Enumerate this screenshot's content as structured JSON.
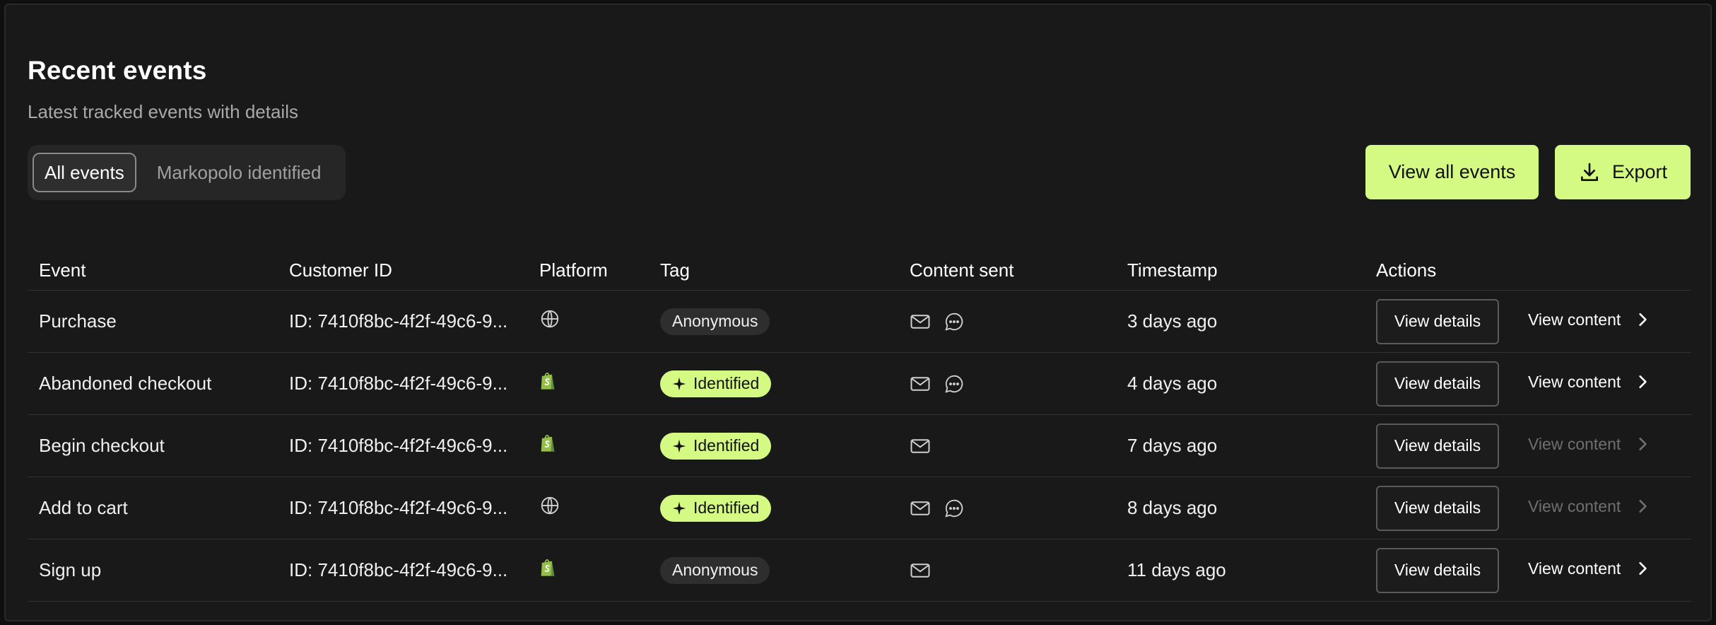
{
  "header": {
    "title": "Recent events",
    "subtitle": "Latest tracked events with details"
  },
  "filters": {
    "options": [
      "All events",
      "Markopolo identified"
    ],
    "selected": "All events"
  },
  "buttons": {
    "view_all": "View all events",
    "export": "Export"
  },
  "table": {
    "columns": [
      "Event",
      "Customer ID",
      "Platform",
      "Tag",
      "Content sent",
      "Timestamp",
      "Actions"
    ],
    "rows": [
      {
        "event": "Purchase",
        "customer_id": "ID: 7410f8bc-4f2f-49c6-9...",
        "platform": "globe-icon",
        "tag": "Anonymous",
        "tag_type": "anon",
        "content": [
          "mail-icon",
          "chat-icon"
        ],
        "timestamp": "3 days ago",
        "details": "View details",
        "view_content": "View content",
        "content_enabled": true
      },
      {
        "event": "Abandoned checkout",
        "customer_id": "ID: 7410f8bc-4f2f-49c6-9...",
        "platform": "shopify-icon",
        "tag": "Identified",
        "tag_type": "ident",
        "content": [
          "mail-icon",
          "chat-icon"
        ],
        "timestamp": "4 days ago",
        "details": "View details",
        "view_content": "View content",
        "content_enabled": true
      },
      {
        "event": "Begin checkout",
        "customer_id": "ID: 7410f8bc-4f2f-49c6-9...",
        "platform": "shopify-icon",
        "tag": "Identified",
        "tag_type": "ident",
        "content": [
          "mail-icon"
        ],
        "timestamp": "7 days ago",
        "details": "View details",
        "view_content": "View content",
        "content_enabled": false
      },
      {
        "event": "Add to cart",
        "customer_id": "ID: 7410f8bc-4f2f-49c6-9...",
        "platform": "globe-icon",
        "tag": "Identified",
        "tag_type": "ident",
        "content": [
          "mail-icon",
          "chat-icon"
        ],
        "timestamp": "8 days ago",
        "details": "View details",
        "view_content": "View content",
        "content_enabled": false
      },
      {
        "event": "Sign up",
        "customer_id": "ID: 7410f8bc-4f2f-49c6-9...",
        "platform": "shopify-icon",
        "tag": "Anonymous",
        "tag_type": "anon",
        "content": [
          "mail-icon"
        ],
        "timestamp": "11 days ago",
        "details": "View details",
        "view_content": "View content",
        "content_enabled": true
      }
    ]
  },
  "colors": {
    "accent": "#d4fa83",
    "background": "#191919",
    "muted_text": "#a9a9a9"
  }
}
